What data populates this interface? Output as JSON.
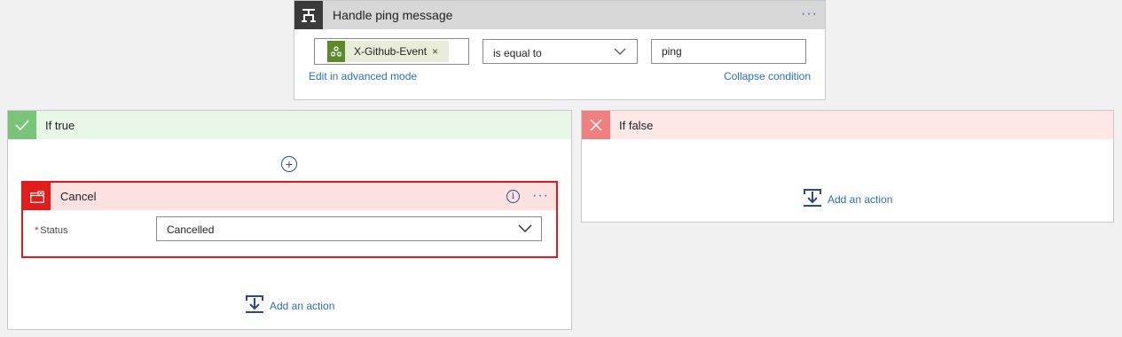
{
  "condition": {
    "title": "Handle ping message",
    "token_label": "X-Github-Event",
    "token_remove": "×",
    "operator": "is equal to",
    "value": "ping",
    "advanced_link": "Edit in advanced mode",
    "collapse_link": "Collapse condition",
    "more_menu": "···"
  },
  "if_true": {
    "title": "If true",
    "add_step": "+",
    "action": {
      "title": "Cancel",
      "info": "i",
      "more_menu": "···",
      "field_required_mark": "*",
      "field_label": "Status",
      "field_value": "Cancelled"
    },
    "add_action": "Add an action"
  },
  "if_false": {
    "title": "If false",
    "add_action": "Add an action"
  },
  "icons": {
    "condition": "condition-icon",
    "github_event": "webhook-icon",
    "operator_chevron": "chevron-down-icon",
    "if_true": "checkmark-icon",
    "if_false": "close-icon",
    "cancel": "cancel-window-icon",
    "add_action": "add-action-icon"
  },
  "colors": {
    "link": "#2a6ebb",
    "true_header": "#e8f6e8",
    "true_icon": "#7ac47a",
    "false_header": "#fde7e7",
    "false_icon": "#f08080",
    "cancel_border": "#e01a1a",
    "cancel_header": "#fde0e0",
    "token_icon": "#5a8a2a"
  }
}
